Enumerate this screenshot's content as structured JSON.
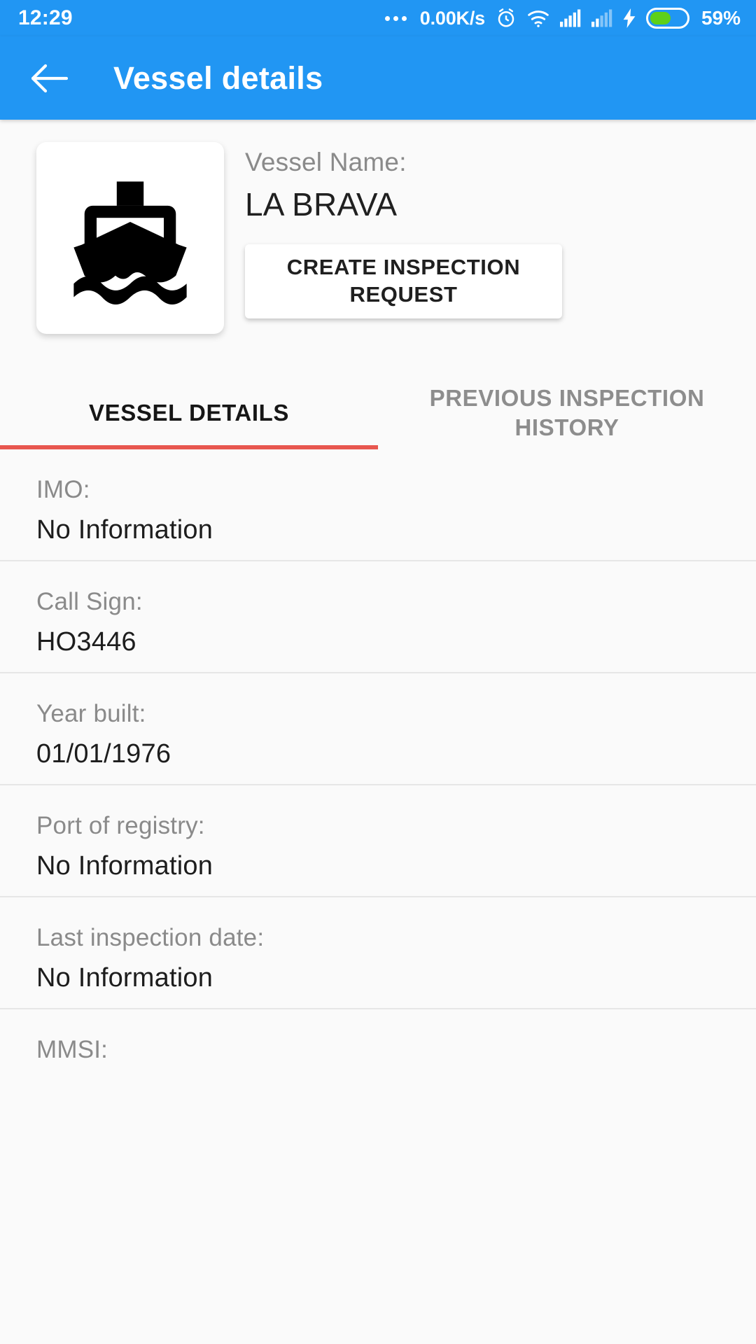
{
  "status_bar": {
    "time": "12:29",
    "network_speed": "0.00K/s",
    "battery_percent": "59%",
    "battery_level": 59,
    "icons": [
      "more-dots-icon",
      "alarm-icon",
      "wifi-icon",
      "signal-icon",
      "signal-icon-2",
      "charging-bolt-icon",
      "battery-icon"
    ],
    "background_color": "#2196f3"
  },
  "app_bar": {
    "title": "Vessel details",
    "back_icon": "back-arrow-icon",
    "background_color": "#2196f3"
  },
  "header": {
    "vessel_icon": "ship-icon",
    "name_label": "Vessel Name:",
    "name_value": "LA BRAVA",
    "create_button_label": "CREATE INSPECTION REQUEST"
  },
  "tabs": {
    "indicator_color": "#e8574f",
    "items": [
      {
        "label": "VESSEL DETAILS",
        "active": true
      },
      {
        "label": "PREVIOUS INSPECTION HISTORY",
        "active": false
      }
    ]
  },
  "details": [
    {
      "label": "IMO:",
      "value": "No Information"
    },
    {
      "label": "Call Sign:",
      "value": "HO3446"
    },
    {
      "label": "Year built:",
      "value": "01/01/1976"
    },
    {
      "label": "Port of registry:",
      "value": "No Information"
    },
    {
      "label": "Last inspection date:",
      "value": "No Information"
    },
    {
      "label": "MMSI:",
      "value": ""
    }
  ]
}
